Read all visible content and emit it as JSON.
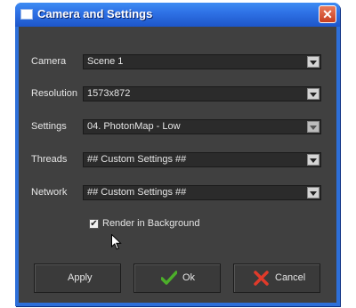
{
  "window": {
    "title": "Camera and Settings",
    "close_glyph": "✕"
  },
  "fields": [
    {
      "label": "Camera",
      "value": "Scene 1"
    },
    {
      "label": "Resolution",
      "value": "1573x872"
    },
    {
      "label": "Settings",
      "value": "04. PhotonMap - Low"
    },
    {
      "label": "Threads",
      "value": "## Custom Settings ##"
    },
    {
      "label": "Network",
      "value": "## Custom Settings ##"
    }
  ],
  "render_background": {
    "label": "Render in Background",
    "checked": true,
    "mark": "✔"
  },
  "buttons": {
    "apply": "Apply",
    "ok": "Ok",
    "cancel": "Cancel"
  },
  "colors": {
    "titlebar": "#2f72e6",
    "client_bg": "#404040",
    "ok_icon": "#4caf2a",
    "cancel_icon": "#e03a2a"
  },
  "icons": {
    "ok": "check-icon",
    "cancel": "x-icon",
    "dropdown": "chevron-down-icon"
  }
}
